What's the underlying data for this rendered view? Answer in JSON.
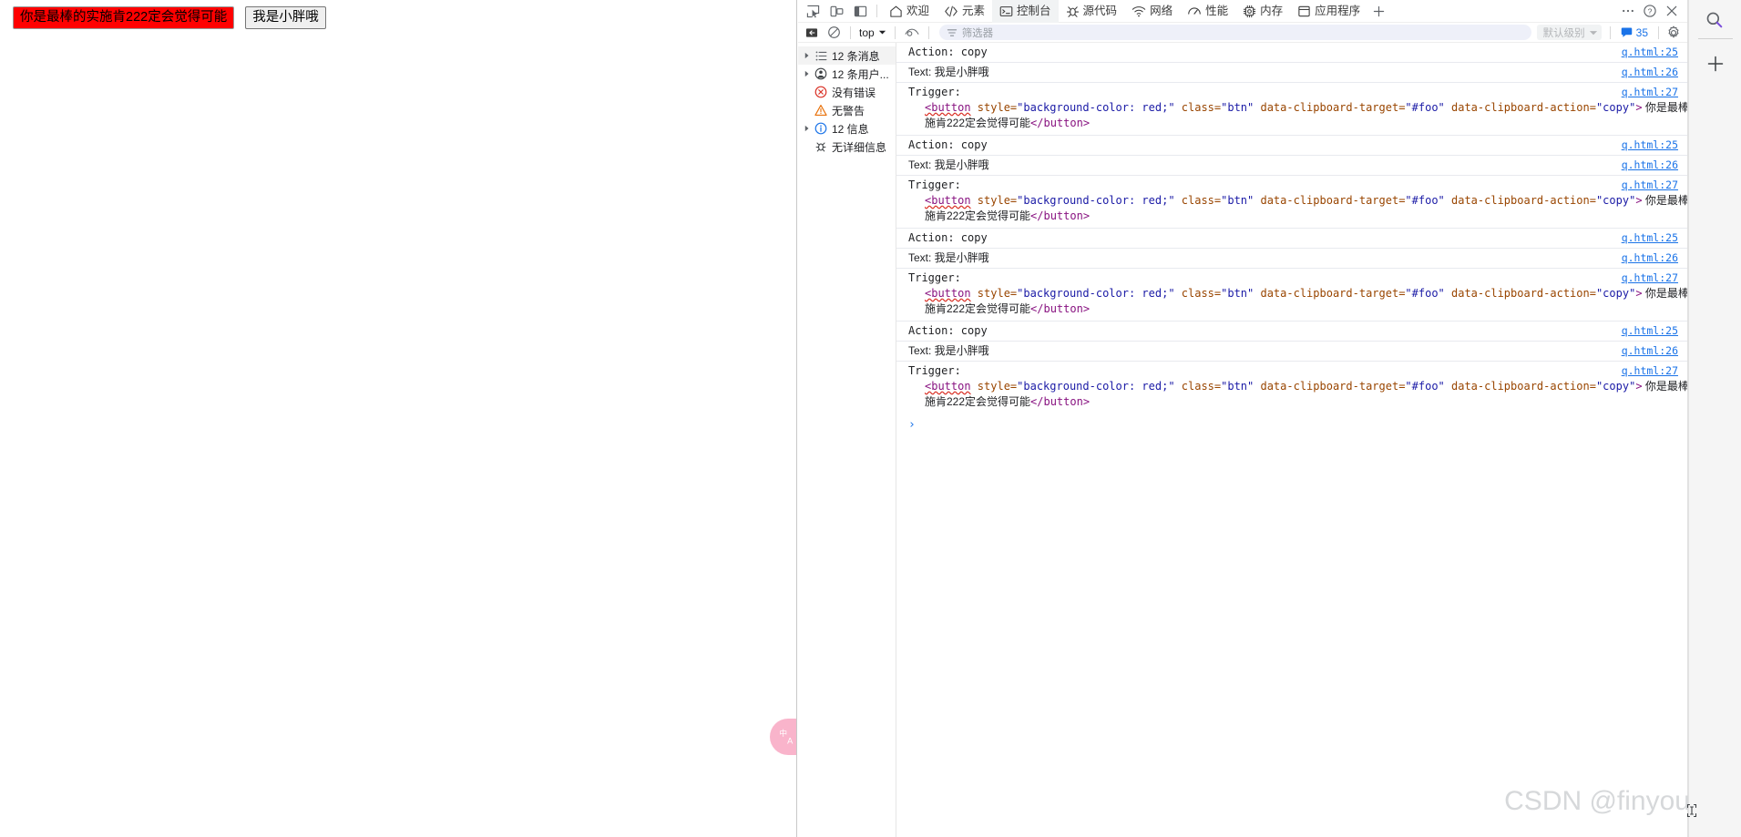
{
  "page": {
    "buttons": [
      {
        "label": "你是最棒的实施肯222定会觉得可能",
        "style": "red",
        "name": "copy-trigger-button"
      },
      {
        "label": "我是小胖哦",
        "style": "plain",
        "name": "copy-source-button"
      }
    ],
    "translate_widget": {
      "label": "中A",
      "icon": "translate-icon"
    }
  },
  "devtools": {
    "device_toggles": [
      {
        "name": "inspect-element-icon"
      },
      {
        "name": "device-toolbar-icon"
      },
      {
        "name": "dock-side-icon"
      }
    ],
    "tabs": [
      {
        "label": "欢迎",
        "icon": "home-icon",
        "active": false
      },
      {
        "label": "元素",
        "icon": "code-icon",
        "active": false
      },
      {
        "label": "控制台",
        "icon": "console-icon",
        "active": true
      },
      {
        "label": "源代码",
        "icon": "bug-icon",
        "active": false
      },
      {
        "label": "网络",
        "icon": "wifi-icon",
        "active": false
      },
      {
        "label": "性能",
        "icon": "performance-icon",
        "active": false
      },
      {
        "label": "内存",
        "icon": "memory-icon",
        "active": false
      },
      {
        "label": "应用程序",
        "icon": "application-icon",
        "active": false
      }
    ],
    "add_tab": {
      "icon": "plus-icon"
    },
    "window_controls": [
      {
        "name": "more-options-icon",
        "glyph": "⋯"
      },
      {
        "name": "help-icon",
        "glyph": "?"
      },
      {
        "name": "close-devtools-icon",
        "glyph": "✕"
      }
    ],
    "filterbar": {
      "clear_console": {
        "name": "clear-console-icon"
      },
      "no_entry": {
        "name": "no-entry-icon"
      },
      "context": {
        "value": "top",
        "name": "execution-context-select"
      },
      "live_expression": {
        "name": "eye-icon"
      },
      "filter": {
        "placeholder": "筛选器",
        "value": ""
      },
      "level": {
        "value": "默认级别",
        "name": "log-level-select"
      },
      "issues": {
        "count": "35",
        "name": "issues-counter"
      },
      "settings": {
        "name": "settings-gear-icon"
      }
    },
    "sidebar": {
      "items": [
        {
          "label": "12 条消息",
          "icon": "messages-icon",
          "expandable": true,
          "selected": true
        },
        {
          "label": "12 条用户...",
          "icon": "user-messages-icon",
          "expandable": true,
          "selected": false
        },
        {
          "label": "没有错误",
          "icon": "error-icon",
          "expandable": false,
          "selected": false
        },
        {
          "label": "无警告",
          "icon": "warning-icon",
          "expandable": false,
          "selected": false
        },
        {
          "label": "12 信息",
          "icon": "info-icon",
          "expandable": true,
          "selected": false
        },
        {
          "label": "无详细信息",
          "icon": "verbose-icon",
          "expandable": false,
          "selected": false
        }
      ]
    },
    "console": {
      "prompt_glyph": "›",
      "code": {
        "tag_open": "<button",
        "attr1_name": " style=",
        "attr1_value": "\"background-color: red;\"",
        "attr2_name": " class=",
        "attr2_value": "\"btn\"",
        "attr3_name": " data-clipboard-target=",
        "attr3_value": "\"#foo\"",
        "attr4_name": " data-clipboard-action=",
        "attr4_value": "\"copy\"",
        "tag_close_bracket": ">",
        "inner_text": " 你是最棒的实",
        "wrap_text": "施肯222定会觉得可能",
        "tag_end": "</button>"
      },
      "groups": [
        {
          "action": {
            "label": "Action: copy",
            "source": "q.html:25"
          },
          "text": {
            "label": "Text: 我是小胖哦",
            "source": "q.html:26"
          },
          "trigger": {
            "label": "Trigger:",
            "source": "q.html:27"
          }
        },
        {
          "action": {
            "label": "Action: copy",
            "source": "q.html:25"
          },
          "text": {
            "label": "Text: 我是小胖哦",
            "source": "q.html:26"
          },
          "trigger": {
            "label": "Trigger:",
            "source": "q.html:27"
          }
        },
        {
          "action": {
            "label": "Action: copy",
            "source": "q.html:25"
          },
          "text": {
            "label": "Text: 我是小胖哦",
            "source": "q.html:26"
          },
          "trigger": {
            "label": "Trigger:",
            "source": "q.html:27"
          }
        },
        {
          "action": {
            "label": "Action: copy",
            "source": "q.html:25"
          },
          "text": {
            "label": "Text: 我是小胖哦",
            "source": "q.html:26"
          },
          "trigger": {
            "label": "Trigger:",
            "source": "q.html:27"
          }
        }
      ]
    }
  },
  "right_rail": {
    "search": {
      "name": "search-icon"
    },
    "add": {
      "name": "plus-icon"
    }
  },
  "watermark": {
    "text": "CSDN @finyou"
  },
  "colors": {
    "accent_link": "#1a73e8",
    "button_red": "#ff0000",
    "tab_active_bg": "#f1f3f4",
    "widget_pink": "#f9b4cb",
    "error_red": "#d93025",
    "warning_orange": "#e8710a"
  }
}
